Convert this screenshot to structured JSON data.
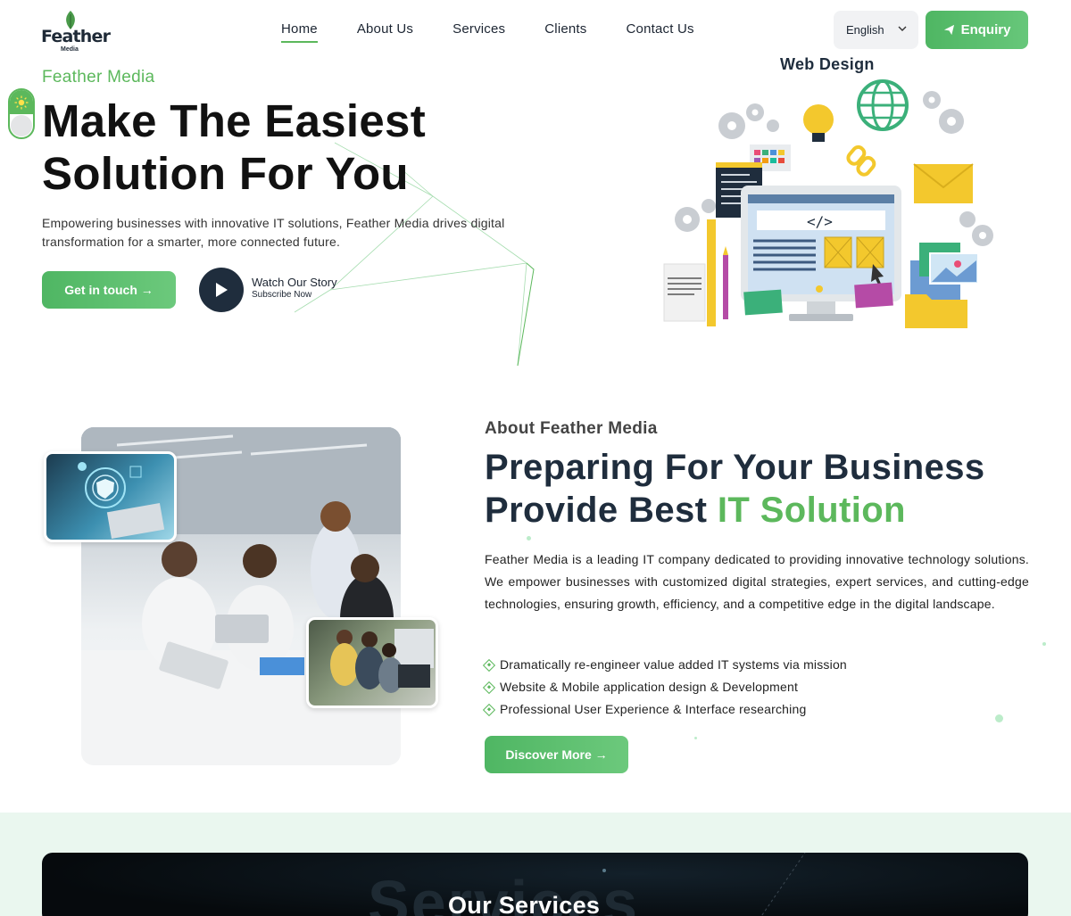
{
  "logo": {
    "brand": "Feather",
    "sub": "Media"
  },
  "nav": {
    "items": [
      {
        "label": "Home",
        "active": true
      },
      {
        "label": "About Us",
        "active": false
      },
      {
        "label": "Services",
        "active": false
      },
      {
        "label": "Clients",
        "active": false
      },
      {
        "label": "Contact Us",
        "active": false
      }
    ]
  },
  "header": {
    "language": "English",
    "enquiry_label": "Enquiry"
  },
  "hero": {
    "eyebrow": "Feather Media",
    "title_line1": "Make The Easiest",
    "title_line2": "Solution For You",
    "description": "Empowering businesses with innovative IT solutions, Feather Media drives digital transformation for a smarter, more connected future.",
    "cta_label": "Get in touch →",
    "watch_title": "Watch Our Story",
    "watch_sub": "Subscribe Now",
    "illustration_label": "Web Design"
  },
  "about": {
    "eyebrow": "About Feather Media",
    "title_line1": "Preparing For Your Business",
    "title_line2_plain": "Provide Best ",
    "title_line2_accent": "IT Solution",
    "description": "Feather Media is a leading IT company dedicated to providing innovative technology solutions. We empower businesses with customized digital strategies, expert services, and cutting-edge technologies, ensuring growth, efficiency, and a competitive edge in the digital landscape.",
    "features": [
      "Dramatically re-engineer value added IT systems via mission",
      "Website & Mobile application design & Development",
      "Professional User Experience & Interface researching"
    ],
    "cta_label": "Discover More →"
  },
  "services": {
    "background_word": "Services",
    "title": "Our Services"
  },
  "colors": {
    "brand_green": "#5cb85c",
    "dark": "#1f2d3d"
  }
}
